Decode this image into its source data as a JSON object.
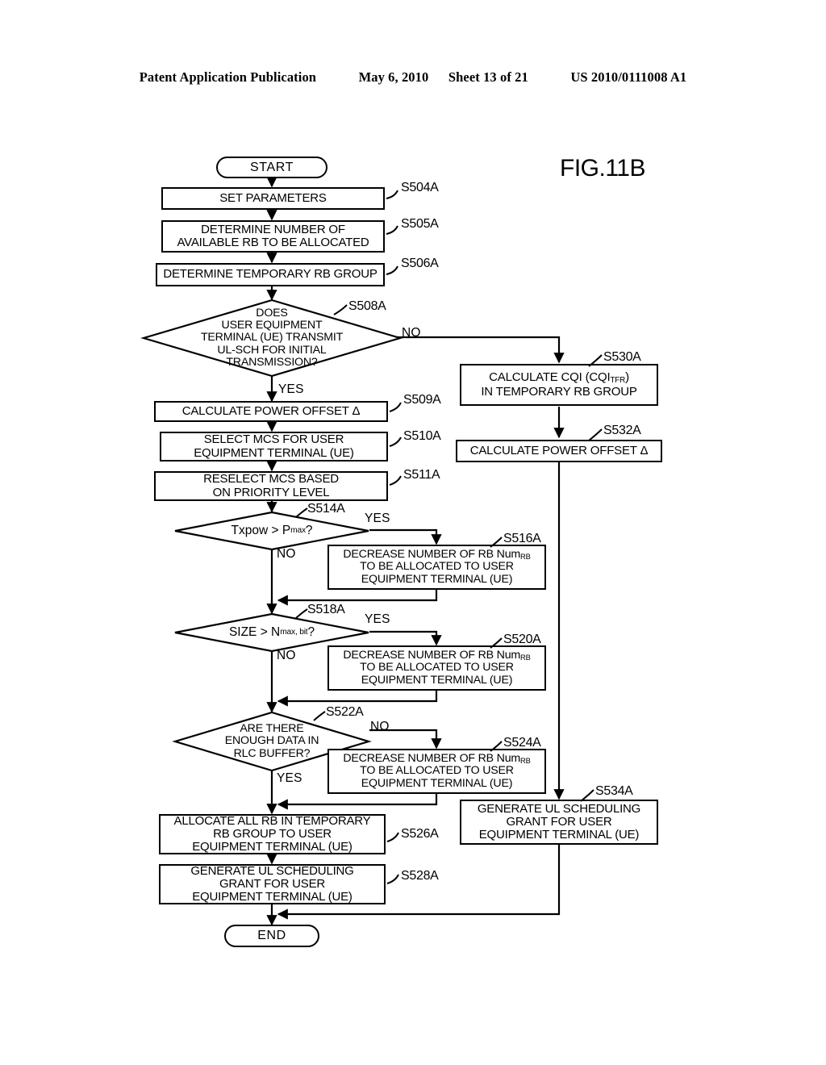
{
  "header": {
    "publication": "Patent Application Publication",
    "date": "May 6, 2010",
    "sheet": "Sheet 13 of 21",
    "patent_number": "US 2010/0111008 A1"
  },
  "figure": {
    "title": "FIG.11B"
  },
  "flowchart": {
    "start_label": "START",
    "end_label": "END",
    "nodes": {
      "s504a": {
        "text": "SET PARAMETERS",
        "tag": "S504A"
      },
      "s505a": {
        "text": "DETERMINE NUMBER OF\nAVAILABLE RB TO BE ALLOCATED",
        "tag": "S505A"
      },
      "s506a": {
        "text": "DETERMINE TEMPORARY RB GROUP",
        "tag": "S506A"
      },
      "s508a": {
        "text": "DOES\nUSER EQUIPMENT\nTERMINAL (UE) TRANSMIT\nUL-SCH FOR INITIAL\nTRANSMISSION?",
        "tag": "S508A"
      },
      "s509a": {
        "text": "CALCULATE POWER OFFSET Δ",
        "tag": "S509A"
      },
      "s510a": {
        "text": "SELECT MCS FOR USER\nEQUIPMENT TERMINAL (UE)",
        "tag": "S510A"
      },
      "s511a": {
        "text": "RESELECT MCS BASED\nON PRIORITY LEVEL",
        "tag": "S511A"
      },
      "s514a": {
        "text": "Txpow > Pmax?",
        "tag": "S514A"
      },
      "s516a": {
        "text": "DECREASE NUMBER OF RB NumRB\nTO BE ALLOCATED TO USER\nEQUIPMENT TERMINAL (UE)",
        "tag": "S516A"
      },
      "s518a": {
        "text": "SIZE > Nmax, bit?",
        "tag": "S518A"
      },
      "s520a": {
        "text": "DECREASE NUMBER OF RB NumRB\nTO BE ALLOCATED TO USER\nEQUIPMENT TERMINAL (UE)",
        "tag": "S520A"
      },
      "s522a": {
        "text": "ARE THERE\nENOUGH DATA IN\nRLC BUFFER?",
        "tag": "S522A"
      },
      "s524a": {
        "text": "DECREASE NUMBER OF RB NumRB\nTO BE ALLOCATED TO USER\nEQUIPMENT TERMINAL (UE)",
        "tag": "S524A"
      },
      "s526a": {
        "text": "ALLOCATE ALL RB IN TEMPORARY\nRB GROUP TO USER\nEQUIPMENT TERMINAL (UE)",
        "tag": "S526A"
      },
      "s528a": {
        "text": "GENERATE UL SCHEDULING\nGRANT FOR USER\nEQUIPMENT TERMINAL (UE)",
        "tag": "S528A"
      },
      "s530a": {
        "text": "CALCULATE CQI (CQITFR)\nIN TEMPORARY RB GROUP",
        "tag": "S530A"
      },
      "s532a": {
        "text": "CALCULATE POWER OFFSET Δ",
        "tag": "S532A"
      },
      "s534a": {
        "text": "GENERATE UL SCHEDULING\nGRANT FOR USER\nEQUIPMENT TERMINAL (UE)",
        "tag": "S534A"
      }
    },
    "branches": {
      "s508a_no": "NO",
      "s508a_yes": "YES",
      "s514a_yes": "YES",
      "s514a_no": "NO",
      "s518a_yes": "YES",
      "s518a_no": "NO",
      "s522a_no": "NO",
      "s522a_yes": "YES"
    }
  },
  "colors": {
    "ink": "#000000",
    "paper": "#ffffff"
  }
}
